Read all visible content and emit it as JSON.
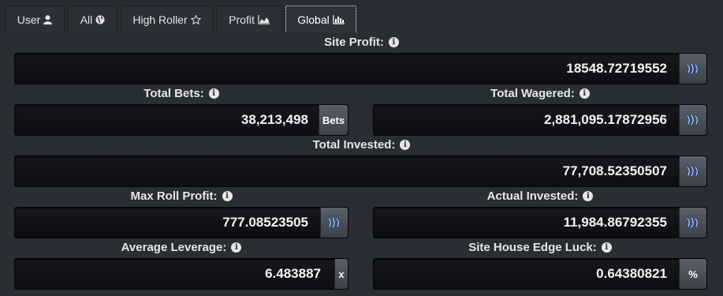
{
  "tabs": [
    {
      "label": "User",
      "icon": "user-icon"
    },
    {
      "label": "All",
      "icon": "globe-icon"
    },
    {
      "label": "High Roller",
      "icon": "star-outline-icon"
    },
    {
      "label": "Profit",
      "icon": "area-chart-icon"
    },
    {
      "label": "Global",
      "icon": "bar-chart-icon",
      "active": true
    }
  ],
  "stats": {
    "site_profit": {
      "label": "Site Profit:",
      "value": "18548.72719552",
      "unit_icon": "steem-icon"
    },
    "total_bets": {
      "label": "Total Bets:",
      "value": "38,213,498",
      "unit": "Bets"
    },
    "total_wagered": {
      "label": "Total Wagered:",
      "value": "2,881,095.17872956",
      "unit_icon": "steem-icon"
    },
    "total_invested": {
      "label": "Total Invested:",
      "value": "77,708.52350507",
      "unit_icon": "steem-icon"
    },
    "max_roll_profit": {
      "label": "Max Roll Profit:",
      "value": "777.08523505",
      "unit_icon": "steem-icon"
    },
    "actual_invested": {
      "label": "Actual Invested:",
      "value": "11,984.86792355",
      "unit_icon": "steem-icon"
    },
    "average_leverage": {
      "label": "Average Leverage:",
      "value": "6.483887",
      "unit": "x"
    },
    "site_house_edge_luck": {
      "label": "Site House Edge Luck:",
      "value": "0.64380821",
      "unit": "%"
    }
  },
  "colors": {
    "background": "#292c33",
    "field": "#111216",
    "addon": "#4a4e57",
    "text": "#ffffff"
  }
}
